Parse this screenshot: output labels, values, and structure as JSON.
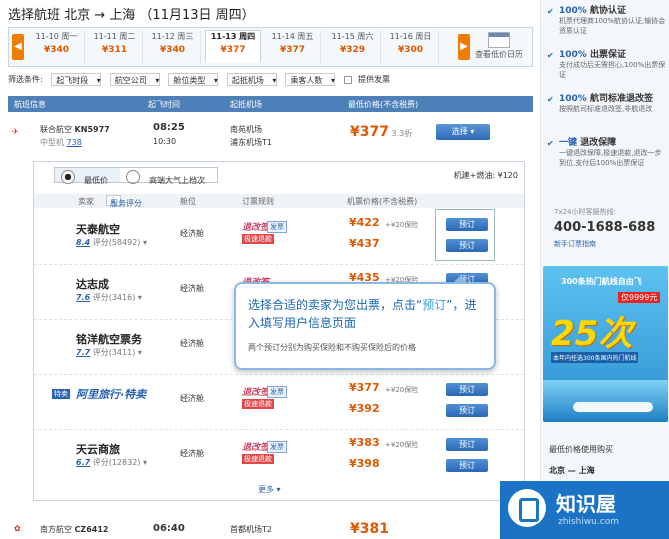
{
  "title": "选择航班 北京 → 上海 （11月13日 周四）",
  "dates": [
    {
      "label": "11-10 周一",
      "price": "¥340"
    },
    {
      "label": "11-11 周二",
      "price": "¥311"
    },
    {
      "label": "11-12 周三",
      "price": "¥340"
    },
    {
      "label": "11-13 周四",
      "price": "¥377"
    },
    {
      "label": "11-14 周五",
      "price": "¥377"
    },
    {
      "label": "11-15 周六",
      "price": "¥329"
    },
    {
      "label": "11-16 周日",
      "price": "¥300"
    }
  ],
  "calendar_label": "查看低价日历",
  "filter": {
    "label": "筛选条件:",
    "options": [
      "起飞时段",
      "航空公司",
      "舱位类型",
      "起抵机场",
      "乘客人数"
    ],
    "checkbox": "提供发票"
  },
  "table_header": {
    "flight": "航班信息",
    "dep_time": "起飞时间",
    "dep_airport": "起抵机场",
    "lowest_price": "最低价格(不含税费)"
  },
  "flight1": {
    "airline": "联合航空",
    "code": "KN5977",
    "model": "中型机",
    "model_code": "738",
    "time": "08:25",
    "arrive_time": "10:30",
    "from": "南苑机场",
    "to": "浦东机场T1",
    "price": "¥377",
    "discount": "3.3折",
    "select": "选择"
  },
  "panel": {
    "tab_lowest": "最低价",
    "tab_premium": "高端大气上档次",
    "fee": "机建+燃油: ¥120",
    "sh": {
      "seller": "卖家",
      "rating": "服务评分",
      "cabin": "舱位",
      "rule": "订票规则",
      "price": "机票价格(不含税费)"
    },
    "sellers": [
      {
        "name": "天泰航空",
        "score": "8.4",
        "count": "评分(58492)",
        "cabin": "经济舱",
        "rule": "退改签",
        "p1": "¥422",
        "p2": "¥437",
        "ins": "+¥20保险"
      },
      {
        "name": "达志成",
        "score": "7.6",
        "count": "评分(3416)",
        "cabin": "经济舱",
        "rule": "退改签",
        "p1": "¥435",
        "p2": "",
        "ins": "+¥20保险"
      },
      {
        "name": "铭洋航空票务",
        "score": "7.7",
        "count": "评分(3411)",
        "cabin": "经济舱",
        "rule": "",
        "p1": "",
        "p2": "",
        "ins": ""
      },
      {
        "name": "阿里旅行·特卖",
        "score": "",
        "count": "",
        "cabin": "经济舱",
        "rule": "退改签",
        "p1": "¥377",
        "p2": "¥392",
        "ins": "+¥20保险"
      },
      {
        "name": "天云商旅",
        "score": "6.7",
        "count": "评分(12832)",
        "cabin": "经济舱",
        "rule": "退改签",
        "p1": "¥383",
        "p2": "¥398",
        "ins": "+¥20保险"
      }
    ],
    "book": "预订",
    "invoice": "发票",
    "rtag": "极速退款",
    "more": "更多"
  },
  "tooltip": {
    "line1a": "选择合适的卖家为您出票，点击“",
    "line1b": "预订",
    "line1c": "”，进入填写用户信息页面",
    "sub": "两个预订分别为购买保险和不购买保险后的价格"
  },
  "flight2": {
    "airline": "南方航空",
    "code": "CZ6412",
    "time": "06:40",
    "airport": "首都机场T2",
    "price": "¥381"
  },
  "right": {
    "features": [
      {
        "pct": "100%",
        "h": "航协认证",
        "d": "机票代理商100%航协认证,输协会资质认证"
      },
      {
        "pct": "100%",
        "h": "出票保证",
        "d": "支付成功后无需担心,100%出票保证"
      },
      {
        "pct": "100%",
        "h": "航司标准退改签",
        "d": "按照航司标准退改签,非航退改"
      },
      {
        "pct": "一键",
        "h": "退改保障",
        "d": "一键退改保障,极速退款,退改一步到位,支付后100%出票保证"
      }
    ],
    "hotline_label": "7x24小时客服热线:",
    "phone": "400-1688-688",
    "help": "新手订票指南",
    "ad": {
      "top": "300条热门航线自由飞",
      "price": "仅9999元",
      "big": "25次",
      "sm": "本年内任选300条国内热门航线"
    },
    "recent": "最低价格使用购买",
    "route": "北京 — 上海"
  },
  "logo": {
    "name": "知识屋",
    "url": "zhishiwu.com"
  }
}
